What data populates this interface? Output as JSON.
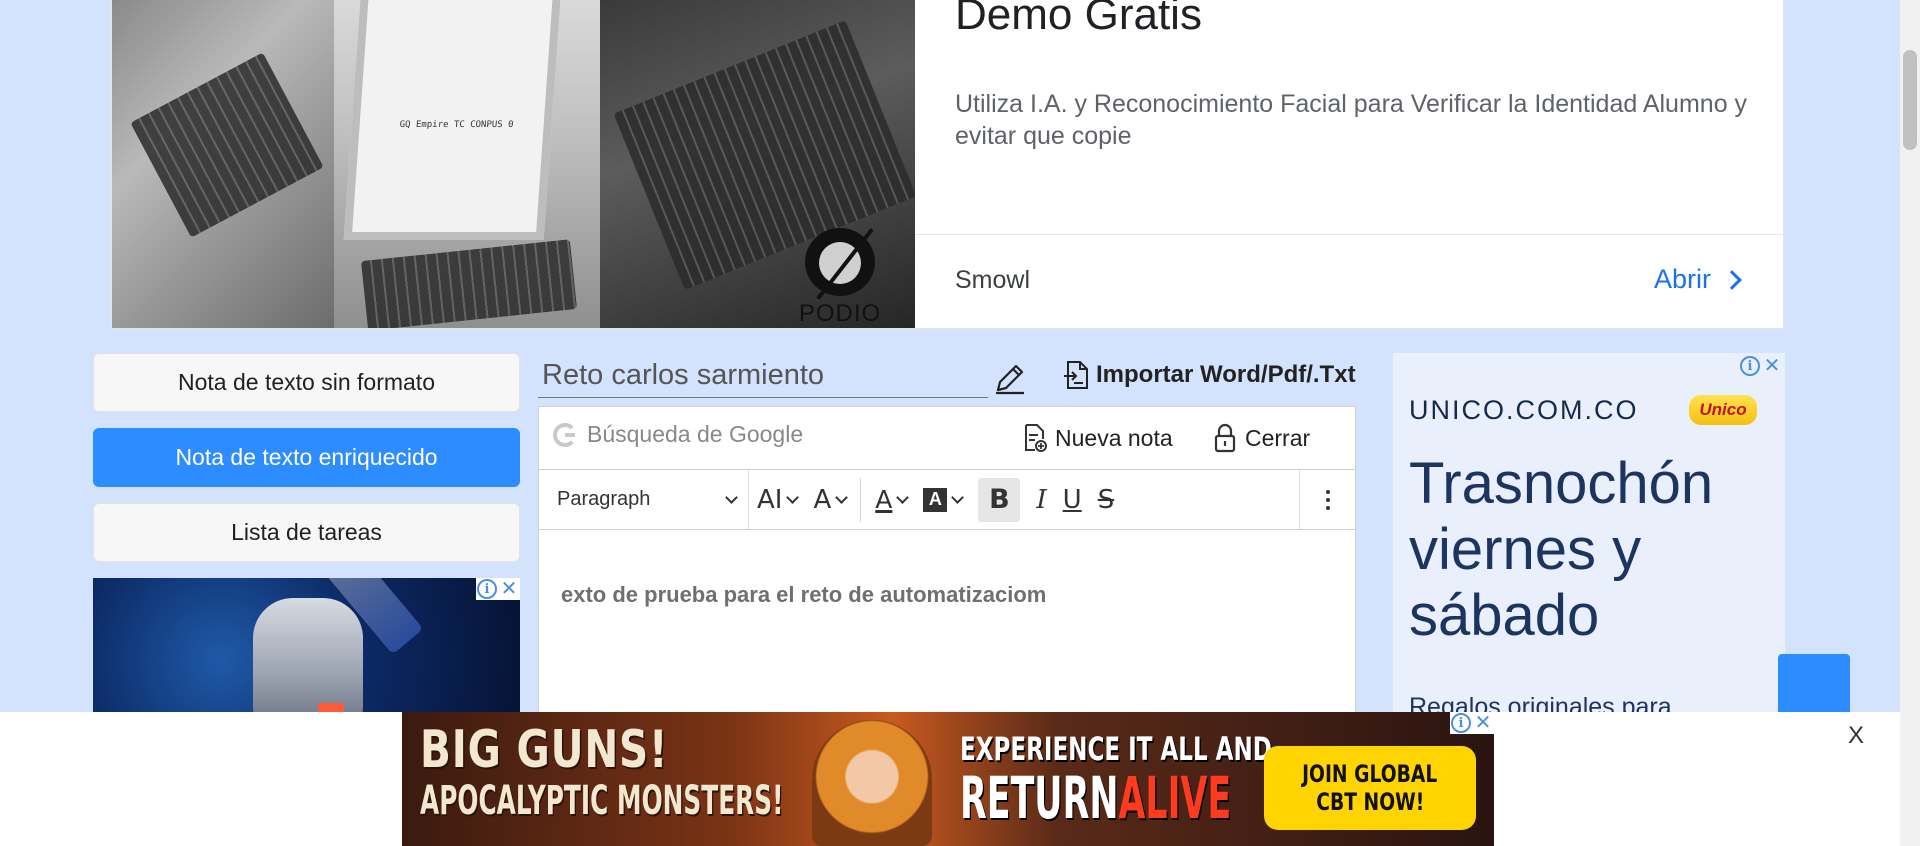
{
  "top_ad": {
    "headline": "Demo Gratis",
    "description": "Utiliza I.A. y Reconocimiento Facial para Verificar la Identidad Alumno y evitar que copie",
    "advertiser": "Smowl",
    "cta": "Abrir",
    "image_brand": "PODIO",
    "screen_text": "GQ  Empire  TC  CONPUS  0"
  },
  "sidebar": {
    "items": [
      {
        "label": "Nota de texto sin formato",
        "active": false
      },
      {
        "label": "Nota de texto enriquecido",
        "active": true
      },
      {
        "label": "Lista de tareas",
        "active": false
      }
    ]
  },
  "note": {
    "title": "Reto carlos sarmiento",
    "import_label": "Importar Word/Pdf/.Txt",
    "search_placeholder": "Búsqueda de Google",
    "new_note_label": "Nueva nota",
    "close_label": "Cerrar",
    "block_format": "Paragraph",
    "body_text": "exto de prueba para el reto de automatizaciom"
  },
  "toolbar_icons": {
    "font_size": "AI",
    "text_size": "A",
    "font_color": "A",
    "bg_color": "A",
    "bold": "B",
    "italic": "I",
    "underline": "U",
    "strike": "S"
  },
  "right_ad": {
    "domain": "UNICO.COM.CO",
    "logo": "Unico",
    "headline": "Trasnochón viernes y sábado",
    "subtext": "Regalos originales para"
  },
  "bottom_banner": {
    "line1": "BIG GUNS!",
    "line2": "APOCALYPTIC MONSTERS!",
    "mid1": "EXPERIENCE IT ALL AND",
    "mid2a": "RETURN",
    "mid2b": "ALIVE",
    "cta1": "JOIN GLOBAL",
    "cta2": "CBT NOW!",
    "close": "X"
  },
  "colors": {
    "page_bg": "#d3e3fd",
    "accent": "#2d8cff",
    "link": "#1a73e8"
  }
}
